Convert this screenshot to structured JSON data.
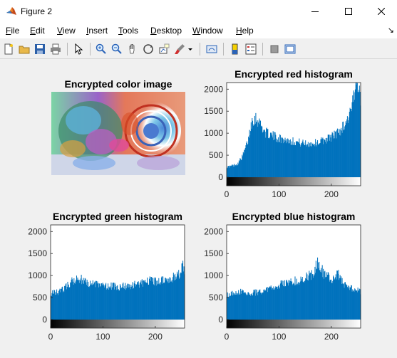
{
  "window": {
    "title": "Figure 2"
  },
  "menu": [
    {
      "label": "File",
      "u": "F",
      "rest": "ile"
    },
    {
      "label": "Edit",
      "u": "E",
      "rest": "dit"
    },
    {
      "label": "View",
      "u": "V",
      "rest": "iew"
    },
    {
      "label": "Insert",
      "u": "I",
      "rest": "nsert"
    },
    {
      "label": "Tools",
      "u": "T",
      "rest": "ools"
    },
    {
      "label": "Desktop",
      "u": "D",
      "rest": "esktop"
    },
    {
      "label": "Window",
      "u": "W",
      "rest": "indow"
    },
    {
      "label": "Help",
      "u": "H",
      "rest": "elp"
    }
  ],
  "toolbar_icons": [
    "new-figure-icon",
    "open-file-icon",
    "save-icon",
    "print-icon",
    "pointer-icon",
    "zoom-in-icon",
    "zoom-out-icon",
    "pan-icon",
    "rotate-3d-icon",
    "data-cursor-icon",
    "brush-icon",
    "link-plot-icon",
    "colorbar-icon",
    "legend-icon",
    "hide-plot-tools-icon",
    "show-plot-tools-icon"
  ],
  "image_panel": {
    "title": "Encrypted color image"
  },
  "chart_data": [
    {
      "type": "bar",
      "title": "Encrypted red histogram",
      "xlim": [
        0,
        255
      ],
      "ylim": [
        0,
        2000
      ],
      "xticks": [
        "0",
        "100",
        "200"
      ],
      "yticks": [
        "0",
        "500",
        "1000",
        "1500",
        "2000"
      ],
      "color": "#0072bd",
      "points": [
        [
          0,
          230
        ],
        [
          10,
          260
        ],
        [
          20,
          300
        ],
        [
          30,
          480
        ],
        [
          40,
          820
        ],
        [
          48,
          1300
        ],
        [
          55,
          1350
        ],
        [
          62,
          1250
        ],
        [
          72,
          1030
        ],
        [
          85,
          950
        ],
        [
          100,
          880
        ],
        [
          115,
          840
        ],
        [
          130,
          810
        ],
        [
          145,
          770
        ],
        [
          158,
          760
        ],
        [
          170,
          780
        ],
        [
          185,
          840
        ],
        [
          200,
          920
        ],
        [
          215,
          1040
        ],
        [
          228,
          1260
        ],
        [
          238,
          1550
        ],
        [
          245,
          1950
        ],
        [
          250,
          2200
        ],
        [
          253,
          2150
        ],
        [
          255,
          1800
        ]
      ]
    },
    {
      "type": "bar",
      "title": "Encrypted green histogram",
      "xlim": [
        0,
        255
      ],
      "ylim": [
        0,
        2000
      ],
      "xticks": [
        "0",
        "100",
        "200"
      ],
      "yticks": [
        "0",
        "500",
        "1000",
        "1500",
        "2000"
      ],
      "color": "#0072bd",
      "points": [
        [
          0,
          600
        ],
        [
          15,
          620
        ],
        [
          30,
          760
        ],
        [
          40,
          870
        ],
        [
          50,
          950
        ],
        [
          60,
          900
        ],
        [
          75,
          820
        ],
        [
          90,
          800
        ],
        [
          110,
          760
        ],
        [
          130,
          740
        ],
        [
          150,
          770
        ],
        [
          170,
          820
        ],
        [
          190,
          880
        ],
        [
          205,
          860
        ],
        [
          220,
          900
        ],
        [
          235,
          960
        ],
        [
          248,
          1050
        ],
        [
          252,
          1250
        ],
        [
          255,
          1150
        ]
      ]
    },
    {
      "type": "bar",
      "title": "Encrypted blue histogram",
      "xlim": [
        0,
        255
      ],
      "ylim": [
        0,
        2000
      ],
      "xticks": [
        "0",
        "100",
        "200"
      ],
      "yticks": [
        "0",
        "500",
        "1000",
        "1500",
        "2000"
      ],
      "color": "#0072bd",
      "points": [
        [
          0,
          560
        ],
        [
          10,
          600
        ],
        [
          25,
          640
        ],
        [
          40,
          600
        ],
        [
          60,
          620
        ],
        [
          80,
          700
        ],
        [
          100,
          790
        ],
        [
          120,
          850
        ],
        [
          140,
          900
        ],
        [
          155,
          980
        ],
        [
          165,
          1050
        ],
        [
          172,
          1280
        ],
        [
          178,
          1200
        ],
        [
          185,
          1050
        ],
        [
          195,
          950
        ],
        [
          205,
          880
        ],
        [
          212,
          1040
        ],
        [
          218,
          900
        ],
        [
          230,
          720
        ],
        [
          245,
          680
        ],
        [
          255,
          650
        ]
      ]
    }
  ]
}
